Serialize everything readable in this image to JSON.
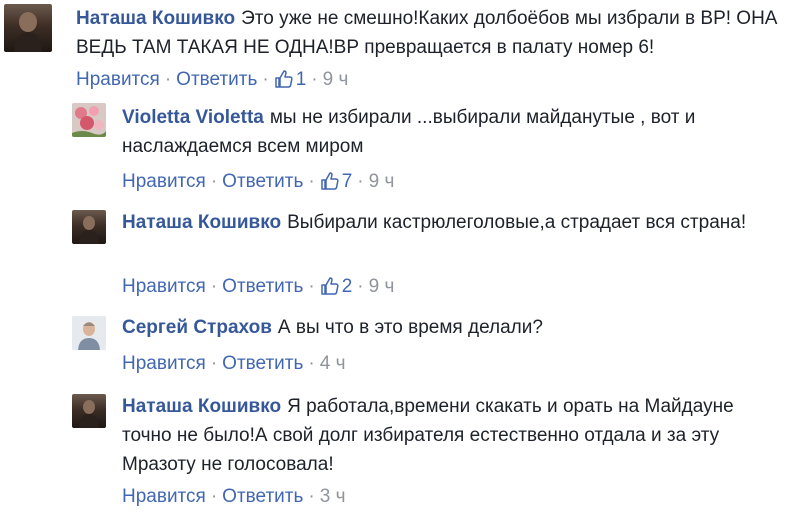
{
  "comments": [
    {
      "author": "Наташа Кошивко",
      "text": "Это уже не смешно!Каких долбоёбов мы избрали в ВР! ОНА ВЕДЬ ТАМ ТАКАЯ НЕ ОДНА!ВР превращается в палату номер 6!",
      "like_label": "Нравится",
      "reply_label": "Ответить",
      "likes": "1",
      "time": "9 ч"
    },
    {
      "author": "Violetta Violetta",
      "text": "мы не избирали ...выбирали майданутые , вот и наслаждаемся всем миром",
      "like_label": "Нравится",
      "reply_label": "Ответить",
      "likes": "7",
      "time": "9 ч"
    },
    {
      "author": "Наташа Кошивко",
      "text": "Выбирали кастрюлеголовые,а страдает вся страна!",
      "like_label": "Нравится",
      "reply_label": "Ответить",
      "likes": "2",
      "time": "9 ч"
    },
    {
      "author": "Сергей Страхов",
      "text": "А вы что в это время делали?",
      "like_label": "Нравится",
      "reply_label": "Ответить",
      "time": "4 ч"
    },
    {
      "author": "Наташа Кошивко",
      "text": "Я работала,времени скакать и орать на Майдауне точно не было!А свой долг избирателя естественно отдала и за эту Мразоту не голосовала!",
      "like_label": "Нравится",
      "reply_label": "Ответить",
      "time": "3 ч"
    }
  ],
  "colors": {
    "author": "#365899",
    "link": "#4267b2",
    "meta": "#90949c",
    "text": "#1d2129"
  },
  "icons": {
    "like": "thumbs-up-icon"
  }
}
